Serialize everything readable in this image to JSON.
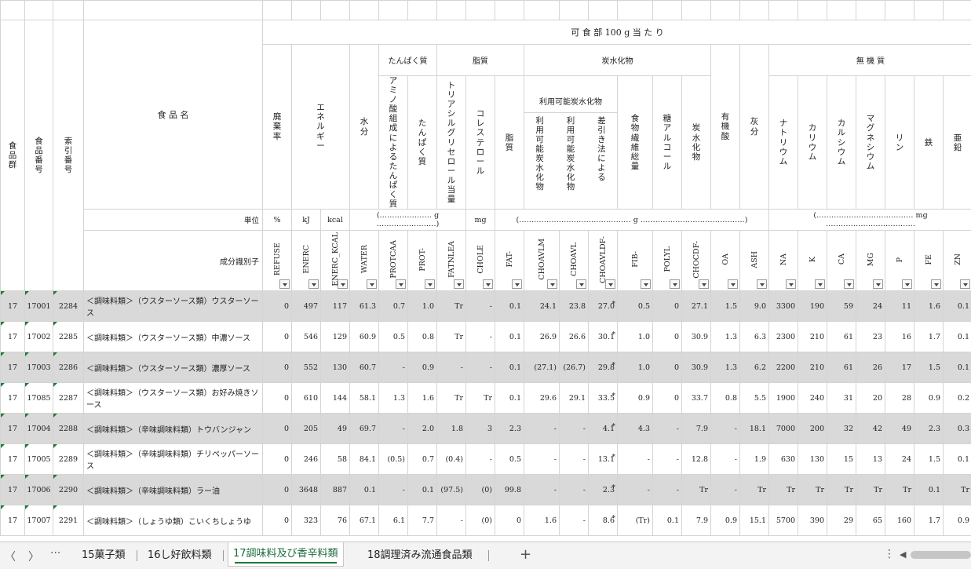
{
  "header": {
    "group": [
      "食",
      "品",
      "群"
    ],
    "food_no": [
      "食",
      "品",
      "番",
      "号"
    ],
    "index_no": [
      "索",
      "引",
      "番",
      "号"
    ],
    "food_name": "食 品 名",
    "per100g": "可 食 部 100 g 当 た り",
    "protein_group": "たんぱく質",
    "lipid_group": "脂質",
    "carb_group": "炭水化物",
    "avail_carb_group": "利用可能炭水化物",
    "mineral_group": "無 機 質",
    "unit_label": "単位",
    "code_label": "成分識別子"
  },
  "columns": [
    {
      "label": [
        "廃",
        "棄",
        "率"
      ],
      "code": "REFUSE",
      "unit": "%"
    },
    {
      "label": [
        "エ",
        "ネ",
        "ル",
        "ギ",
        "ー"
      ],
      "code": "ENERC",
      "unit": "kJ"
    },
    {
      "label": [],
      "code": "ENERC_KCAL",
      "unit": "kcal"
    },
    {
      "label": [
        "水",
        "分"
      ],
      "code": "WATER",
      "unit": "(………………… g ……………………)"
    },
    {
      "label": [
        "ア",
        "ミ",
        "ノ",
        "酸",
        "組",
        "成",
        "に",
        "よ",
        "る",
        "た",
        "ん",
        "ぱ",
        "く",
        "質"
      ],
      "code": "PROTCAA",
      "unit": ""
    },
    {
      "label": [
        "た",
        "ん",
        "ぱ",
        "く",
        "質"
      ],
      "code": "PROT-",
      "unit": ""
    },
    {
      "label": [
        "ト",
        "リ",
        "ア",
        "シ",
        "ル",
        "グ",
        "リ",
        "セ",
        "ロ",
        "ー",
        "ル",
        "当",
        "量"
      ],
      "code": "FATNLEA",
      "unit": ""
    },
    {
      "label": [
        "コ",
        "レ",
        "ス",
        "テ",
        "ロ",
        "ー",
        "ル"
      ],
      "code": "CHOLE",
      "unit": "mg"
    },
    {
      "label": [
        "脂",
        "質"
      ],
      "code": "FAT-",
      "unit": "(……………………………………… g ……………………………………)"
    },
    {
      "label": [
        "利",
        "用",
        "可",
        "能",
        "炭",
        "水",
        "化",
        "物"
      ],
      "code": "CHOAVLM",
      "unit": ""
    },
    {
      "label": [
        "利",
        "用",
        "可",
        "能",
        "炭",
        "水",
        "化",
        "物"
      ],
      "code": "CHOAVL",
      "unit": ""
    },
    {
      "label": [
        "差",
        "引",
        "き",
        "法",
        "に",
        "よ",
        "る"
      ],
      "code": "CHOAVLDF-",
      "unit": ""
    },
    {
      "label": [
        "食",
        "物",
        "繊",
        "維",
        "総",
        "量"
      ],
      "code": "FIB-",
      "unit": ""
    },
    {
      "label": [
        "糖",
        "ア",
        "ル",
        "コ",
        "ー",
        "ル"
      ],
      "code": "POLYL",
      "unit": ""
    },
    {
      "label": [
        "炭",
        "水",
        "化",
        "物"
      ],
      "code": "CHOCDF-",
      "unit": ""
    },
    {
      "label": [
        "有",
        "機",
        "酸"
      ],
      "code": "OA",
      "unit": ""
    },
    {
      "label": [
        "灰",
        "分"
      ],
      "code": "ASH",
      "unit": ""
    },
    {
      "label": [
        "ナ",
        "ト",
        "リ",
        "ウ",
        "ム"
      ],
      "code": "NA",
      "unit": "(………………………………… mg ………………………………"
    },
    {
      "label": [
        "カ",
        "リ",
        "ウ",
        "ム"
      ],
      "code": "K",
      "unit": ""
    },
    {
      "label": [
        "カ",
        "ル",
        "シ",
        "ウ",
        "ム"
      ],
      "code": "CA",
      "unit": ""
    },
    {
      "label": [
        "マ",
        "グ",
        "ネ",
        "シ",
        "ウ",
        "ム"
      ],
      "code": "MG",
      "unit": ""
    },
    {
      "label": [
        "リ",
        "ン"
      ],
      "code": "P",
      "unit": ""
    },
    {
      "label": [
        "鉄"
      ],
      "code": "FE",
      "unit": ""
    },
    {
      "label": [
        "亜",
        "鉛"
      ],
      "code": "ZN",
      "unit": ""
    }
  ],
  "rows": [
    {
      "group": "17",
      "no": "17001",
      "idx": "2284",
      "name": "＜調味料類＞（ウスターソース類）ウスターソース",
      "v": [
        "0",
        "497",
        "117",
        "61.3",
        "0.7",
        "1.0",
        "Tr",
        "-",
        "0.1",
        "24.1",
        "23.8",
        "27.0",
        "0.5",
        "0",
        "27.1",
        "1.5",
        "9.0",
        "3300",
        "190",
        "59",
        "24",
        "11",
        "1.6",
        "0.1"
      ]
    },
    {
      "group": "17",
      "no": "17002",
      "idx": "2285",
      "name": "＜調味料類＞（ウスターソース類）中濃ソース",
      "v": [
        "0",
        "546",
        "129",
        "60.9",
        "0.5",
        "0.8",
        "Tr",
        "-",
        "0.1",
        "26.9",
        "26.6",
        "30.1",
        "1.0",
        "0",
        "30.9",
        "1.3",
        "6.3",
        "2300",
        "210",
        "61",
        "23",
        "16",
        "1.7",
        "0.1"
      ]
    },
    {
      "group": "17",
      "no": "17003",
      "idx": "2286",
      "name": "＜調味料類＞（ウスターソース類）濃厚ソース",
      "v": [
        "0",
        "552",
        "130",
        "60.7",
        "-",
        "0.9",
        "-",
        "-",
        "0.1",
        "(27.1)",
        "(26.7)",
        "29.8",
        "1.0",
        "0",
        "30.9",
        "1.3",
        "6.2",
        "2200",
        "210",
        "61",
        "26",
        "17",
        "1.5",
        "0.1"
      ]
    },
    {
      "group": "17",
      "no": "17085",
      "idx": "2287",
      "name": "＜調味料類＞（ウスターソース類）お好み焼きソース",
      "v": [
        "0",
        "610",
        "144",
        "58.1",
        "1.3",
        "1.6",
        "Tr",
        "Tr",
        "0.1",
        "29.6",
        "29.1",
        "33.5",
        "0.9",
        "0",
        "33.7",
        "0.8",
        "5.5",
        "1900",
        "240",
        "31",
        "20",
        "28",
        "0.9",
        "0.2"
      ]
    },
    {
      "group": "17",
      "no": "17004",
      "idx": "2288",
      "name": "＜調味料類＞（辛味調味料類）トウバンジャン",
      "v": [
        "0",
        "205",
        "49",
        "69.7",
        "-",
        "2.0",
        "1.8",
        "3",
        "2.3",
        "-",
        "-",
        "4.1",
        "4.3",
        "-",
        "7.9",
        "-",
        "18.1",
        "7000",
        "200",
        "32",
        "42",
        "49",
        "2.3",
        "0.3"
      ]
    },
    {
      "group": "17",
      "no": "17005",
      "idx": "2289",
      "name": "＜調味料類＞（辛味調味料類）チリペッパーソース",
      "v": [
        "0",
        "246",
        "58",
        "84.1",
        "(0.5)",
        "0.7",
        "(0.4)",
        "-",
        "0.5",
        "-",
        "-",
        "13.1",
        "-",
        "-",
        "12.8",
        "-",
        "1.9",
        "630",
        "130",
        "15",
        "13",
        "24",
        "1.5",
        "0.1"
      ]
    },
    {
      "group": "17",
      "no": "17006",
      "idx": "2290",
      "name": "＜調味料類＞（辛味調味料類）ラー油",
      "v": [
        "0",
        "3648",
        "887",
        "0.1",
        "-",
        "0.1",
        "(97.5)",
        "(0)",
        "99.8",
        "-",
        "-",
        "2.3",
        "-",
        "-",
        "Tr",
        "-",
        "Tr",
        "Tr",
        "Tr",
        "Tr",
        "Tr",
        "Tr",
        "0.1",
        "Tr"
      ]
    },
    {
      "group": "17",
      "no": "17007",
      "idx": "2291",
      "name": "＜調味料類＞（しょうゆ類）こいくちしょうゆ",
      "v": [
        "0",
        "323",
        "76",
        "67.1",
        "6.1",
        "7.7",
        "-",
        "(0)",
        "0",
        "1.6",
        "-",
        "8.6",
        "(Tr)",
        "0.1",
        "7.9",
        "0.9",
        "15.1",
        "5700",
        "390",
        "29",
        "65",
        "160",
        "1.7",
        "0.9"
      ]
    }
  ],
  "tabs": [
    "15菓子類",
    "16し好飲料類",
    "17調味料及び香辛料類",
    "18調理済み流通食品類"
  ],
  "active_tab": "17調味料及び香辛料類",
  "add_sheet_label": "+",
  "nav": {
    "prev": "〈",
    "next": "〉",
    "more": "···",
    "menu": "⋮",
    "scroll_left": "◀"
  }
}
